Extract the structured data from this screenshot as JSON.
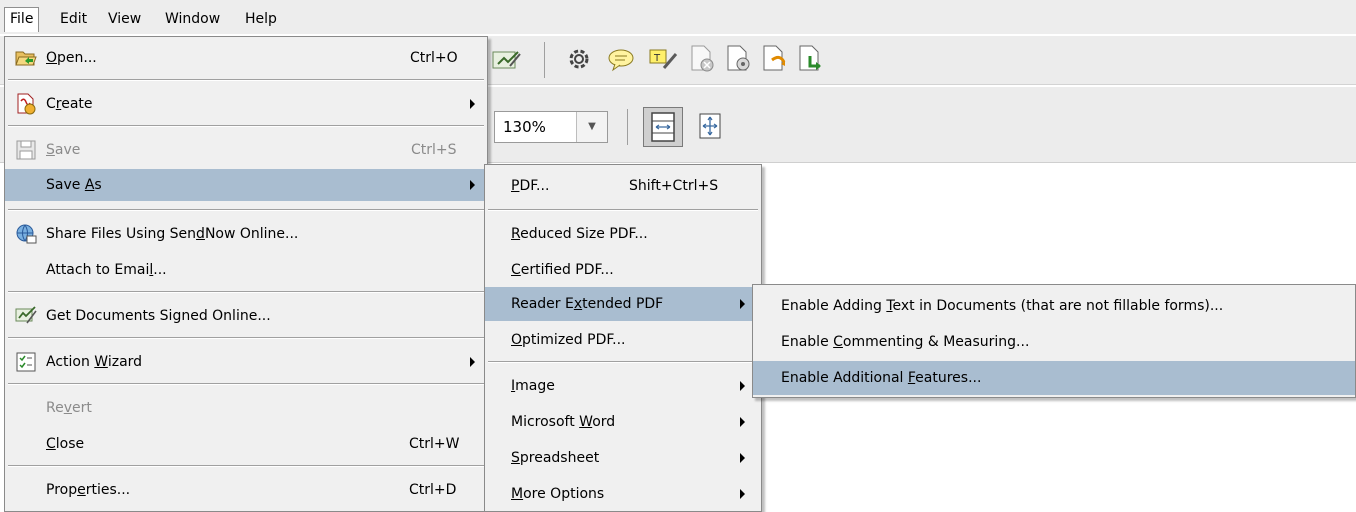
{
  "menubar": {
    "items": [
      {
        "label": "File"
      },
      {
        "label": "Edit"
      },
      {
        "label": "View"
      },
      {
        "label": "Window"
      },
      {
        "label": "Help"
      }
    ]
  },
  "toolbar": {
    "zoom": "130%",
    "icons": [
      "sign-icon",
      "gear-icon",
      "comment-icon",
      "highlight-icon",
      "pdf-disabled-icon",
      "pdf-settings-icon",
      "pdf-export-icon",
      "pdf-reduce-icon",
      "fit-page-icon",
      "full-screen-icon"
    ]
  },
  "file_menu": {
    "open": {
      "label_pre": "",
      "label_u": "O",
      "label_post": "pen...",
      "shortcut": "Ctrl+O"
    },
    "create": {
      "label_pre": "C",
      "label_u": "r",
      "label_post": "eate"
    },
    "save": {
      "label_pre": "",
      "label_u": "S",
      "label_post": "ave",
      "shortcut": "Ctrl+S"
    },
    "save_as": {
      "label_pre": "Save ",
      "label_u": "A",
      "label_post": "s"
    },
    "share": {
      "label_pre": "Share Files Using Sen",
      "label_u": "d",
      "label_post": "Now Online..."
    },
    "attach": {
      "label_pre": "Attach to Emai",
      "label_u": "l",
      "label_post": "..."
    },
    "get_signed": {
      "label": "Get Documents Signed Online..."
    },
    "action_wizard": {
      "label_pre": "Action ",
      "label_u": "W",
      "label_post": "izard"
    },
    "revert": {
      "label_pre": "Re",
      "label_u": "v",
      "label_post": "ert"
    },
    "close": {
      "label_pre": "",
      "label_u": "C",
      "label_post": "lose",
      "shortcut": "Ctrl+W"
    },
    "properties": {
      "label_pre": "Prop",
      "label_u": "e",
      "label_post": "rties...",
      "shortcut": "Ctrl+D"
    }
  },
  "save_as_menu": {
    "pdf": {
      "label_pre": "",
      "label_u": "P",
      "label_post": "DF...",
      "shortcut": "Shift+Ctrl+S"
    },
    "reduced": {
      "label_pre": "",
      "label_u": "R",
      "label_post": "educed Size PDF..."
    },
    "certified": {
      "label_pre": "",
      "label_u": "C",
      "label_post": "ertified PDF..."
    },
    "reader_extended": {
      "label_pre": "Reader E",
      "label_u": "x",
      "label_post": "tended PDF"
    },
    "optimized": {
      "label_pre": "",
      "label_u": "O",
      "label_post": "ptimized PDF..."
    },
    "image": {
      "label_pre": "",
      "label_u": "I",
      "label_post": "mage"
    },
    "word": {
      "label_pre": "Microsoft ",
      "label_u": "W",
      "label_post": "ord"
    },
    "spreadsheet": {
      "label_pre": "",
      "label_u": "S",
      "label_post": "preadsheet"
    },
    "more": {
      "label_pre": "",
      "label_u": "M",
      "label_post": "ore Options"
    }
  },
  "reader_menu": {
    "adding_text": {
      "label_pre": "Enable Adding ",
      "label_u": "T",
      "label_post": "ext in Documents (that are not fillable forms)..."
    },
    "commenting": {
      "label_pre": "Enable ",
      "label_u": "C",
      "label_post": "ommenting & Measuring..."
    },
    "additional": {
      "label_pre": "Enable Additional ",
      "label_u": "F",
      "label_post": "eatures..."
    }
  }
}
